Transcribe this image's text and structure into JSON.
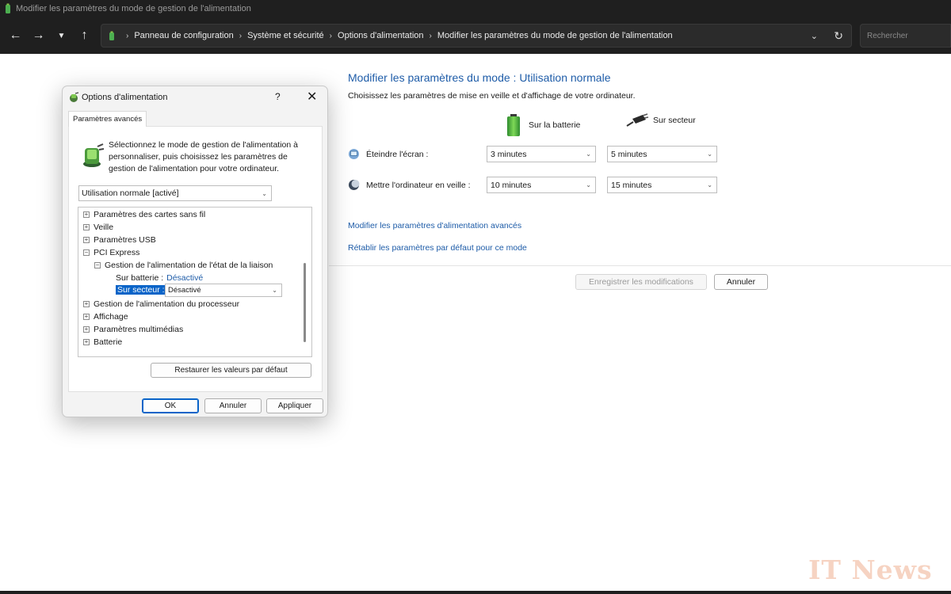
{
  "window": {
    "title": "Modifier les paramètres du mode de gestion de l'alimentation"
  },
  "address_bar": {
    "breadcrumbs": [
      "Panneau de configuration",
      "Système et sécurité",
      "Options d'alimentation",
      "Modifier les paramètres du mode de gestion de l'alimentation"
    ],
    "search_placeholder": "Rechercher"
  },
  "main": {
    "title": "Modifier les paramètres du mode : Utilisation normale",
    "subtitle": "Choisissez les paramètres de mise en veille et d'affichage de votre ordinateur.",
    "col_battery": "Sur la batterie",
    "col_plugged": "Sur secteur",
    "rows": [
      {
        "label": "Éteindre l'écran :",
        "battery": "3 minutes",
        "plugged": "5 minutes"
      },
      {
        "label": "Mettre l'ordinateur en veille :",
        "battery": "10 minutes",
        "plugged": "15 minutes"
      }
    ],
    "link_advanced": "Modifier les paramètres d'alimentation avancés",
    "link_restore": "Rétablir les paramètres par défaut pour ce mode",
    "save_button": "Enregistrer les modifications",
    "cancel_button": "Annuler"
  },
  "dialog": {
    "title": "Options d'alimentation",
    "help": "?",
    "tab": "Paramètres avancés",
    "description": "Sélectionnez le mode de gestion de l'alimentation à personnaliser, puis choisissez les paramètres de gestion de l'alimentation pour votre ordinateur.",
    "plan": "Utilisation normale [activé]",
    "tree": {
      "wireless": "Paramètres des cartes sans fil",
      "sleep": "Veille",
      "usb": "Paramètres USB",
      "pci": "PCI Express",
      "link_state": "Gestion de l'alimentation de l'état de la liaison",
      "on_battery_label": "Sur batterie :",
      "on_battery_value": "Désactivé",
      "plugged_label": "Sur secteur :",
      "plugged_value": "Désactivé",
      "processor": "Gestion de l'alimentation du processeur",
      "display": "Affichage",
      "multimedia": "Paramètres multimédias",
      "battery": "Batterie"
    },
    "restore_button": "Restaurer les valeurs par défaut",
    "ok_button": "OK",
    "cancel_button": "Annuler",
    "apply_button": "Appliquer"
  },
  "watermark": "IT News",
  "colors": {
    "accent": "#0a64c8",
    "link": "#1e5ca8",
    "titlebar": "#1f1f1f"
  },
  "icons": [
    "battery-icon",
    "plug-icon",
    "monitor-icon",
    "moon-icon",
    "power-options-icon",
    "back-icon",
    "forward-icon",
    "refresh-icon"
  ]
}
